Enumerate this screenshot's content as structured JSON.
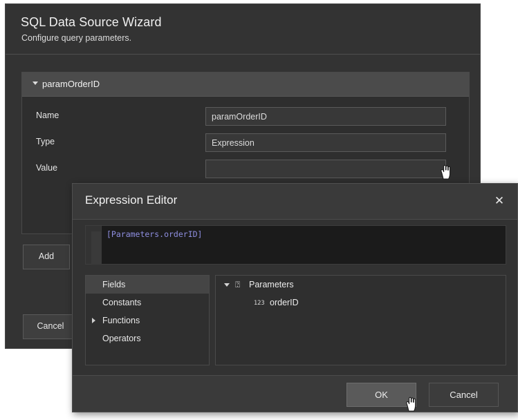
{
  "wizard": {
    "title": "SQL Data Source Wizard",
    "subtitle": "Configure query parameters.",
    "group": {
      "name": "paramOrderID",
      "caret_icon": "triangle-down-icon"
    },
    "fields": [
      {
        "label": "Name",
        "value": "paramOrderID",
        "kind": "text"
      },
      {
        "label": "Type",
        "value": "Expression",
        "kind": "combo"
      },
      {
        "label": "Value",
        "value": "",
        "kind": "ellipsis"
      }
    ],
    "ellipsis_label": "...",
    "add_label": "Add",
    "cancel_label": "Cancel"
  },
  "dialog": {
    "title": "Expression Editor",
    "close_label": "✕",
    "expression": "[Parameters.orderID]",
    "categories": [
      {
        "label": "Fields",
        "selected": true,
        "expandable": false
      },
      {
        "label": "Constants",
        "selected": false,
        "expandable": false
      },
      {
        "label": "Functions",
        "selected": false,
        "expandable": true
      },
      {
        "label": "Operators",
        "selected": false,
        "expandable": false
      }
    ],
    "tree": {
      "root": {
        "label": "Parameters",
        "icon": "parameter-icon",
        "icon_glyph": "⍰",
        "expanded": true
      },
      "children": [
        {
          "label": "orderID",
          "icon": "number-type-icon",
          "icon_glyph": "123"
        }
      ]
    },
    "ok_label": "OK",
    "cancel_label": "Cancel"
  },
  "colors": {
    "window_bg": "#333333",
    "panel_bg": "#2e2e2e",
    "dialog_bg": "#3a3a3a",
    "editor_bg": "#1b1b1b",
    "expression_text": "#8e8ee0",
    "accent_arrow": "#d8ae7a",
    "page_bg": "#ffffff"
  }
}
